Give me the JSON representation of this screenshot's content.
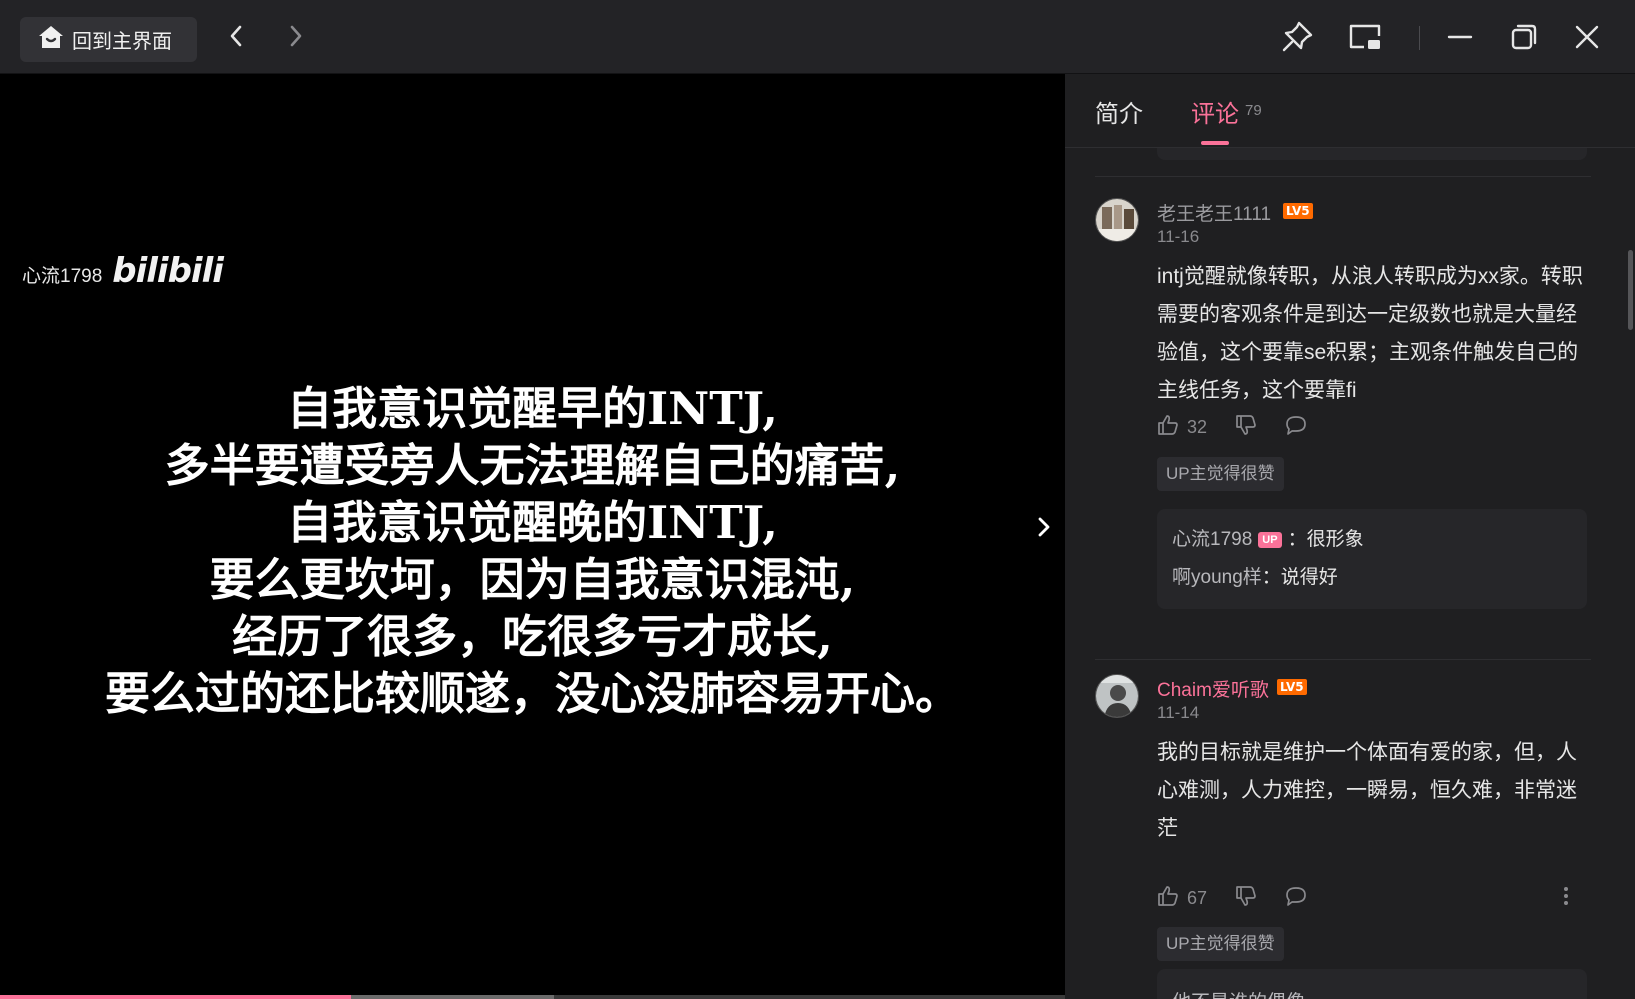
{
  "titlebar": {
    "home_label": "回到主界面"
  },
  "video": {
    "watermark_user": "心流1798",
    "watermark_logo": "bilibili",
    "subtitle_lines": [
      "自我意识觉醒早的INTJ,",
      "多半要遭受旁人无法理解自己的痛苦,",
      "自我意识觉醒晚的INTJ,",
      "要么更坎坷，因为自我意识混沌,",
      "经历了很多，吃很多亏才成长,",
      "要么过的还比较顺遂，没心没肺容易开心。"
    ],
    "progress_percent": 33,
    "accent_color": "#fb7299"
  },
  "panel": {
    "tab_intro": "简介",
    "tab_comments": "评论",
    "comment_count": "79"
  },
  "comments": [
    {
      "user": "老王老王1111",
      "user_color": "#9a9a9e",
      "level": "LV5",
      "date": "11-16",
      "text": "intj觉醒就像转职，从浪人转职成为xx家。转职需要的客观条件是到达一定级数也就是大量经验值，这个要靠se积累；主观条件触发自己的主线任务，这个要靠fi",
      "likes": "32",
      "badge": "UP主觉得很赞",
      "replies": [
        {
          "user": "心流1798",
          "is_up": true,
          "up_label": "UP",
          "sep": "：",
          "text": "很形象"
        },
        {
          "user": "啊young样",
          "is_up": false,
          "sep": "：",
          "text": "说得好"
        }
      ]
    },
    {
      "user": "Chaim爱听歌",
      "user_color": "#fb7299",
      "level": "LV5",
      "date": "11-14",
      "text": "我的目标就是维护一个体面有爱的家，但，人心难测，人力难控，一瞬易，恒久难，非常迷茫",
      "likes": "67",
      "badge": "UP主觉得很赞",
      "reply_preview": "他不是谁的偶像"
    }
  ],
  "icons": {
    "home": "home-icon",
    "back": "chevron-left-icon",
    "forward": "chevron-right-icon",
    "pin": "pin-icon",
    "mini": "mini-window-icon",
    "minimize": "minimize-icon",
    "restore": "restore-icon",
    "close": "close-icon",
    "like": "thumbs-up-icon",
    "dislike": "thumbs-down-icon",
    "reply": "comment-bubble-icon",
    "more": "more-vertical-icon"
  }
}
